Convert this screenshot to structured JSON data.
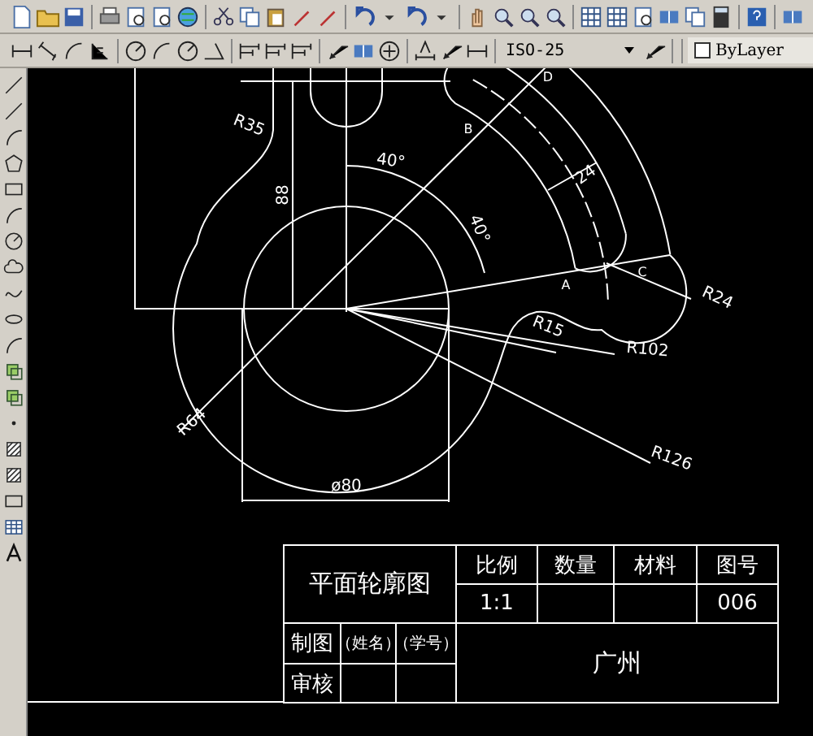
{
  "toolbar": {
    "dim_style": "ISO-25",
    "layer_checkbox": {
      "label": "ByLayer",
      "checked": false
    }
  },
  "drawing": {
    "labels": [
      {
        "text": "R35"
      },
      {
        "text": "88"
      },
      {
        "text": "40°"
      },
      {
        "text": "40°"
      },
      {
        "text": "24"
      },
      {
        "text": "A"
      },
      {
        "text": "B"
      },
      {
        "text": "C"
      },
      {
        "text": "D"
      },
      {
        "text": "R24"
      },
      {
        "text": "R15"
      },
      {
        "text": "R102"
      },
      {
        "text": "R126"
      },
      {
        "text": "R64"
      },
      {
        "text": "ø80"
      }
    ]
  },
  "title_block": {
    "title": "平面轮廓图",
    "columns": [
      {
        "header": "比例",
        "value": "1:1"
      },
      {
        "header": "数量"
      },
      {
        "header": "材料"
      },
      {
        "header": "图号",
        "value": "006"
      }
    ],
    "rows": [
      {
        "role": "制图",
        "name": "（姓名）",
        "number": "（学号）"
      },
      {
        "role": "审核"
      }
    ],
    "school": "广州"
  }
}
